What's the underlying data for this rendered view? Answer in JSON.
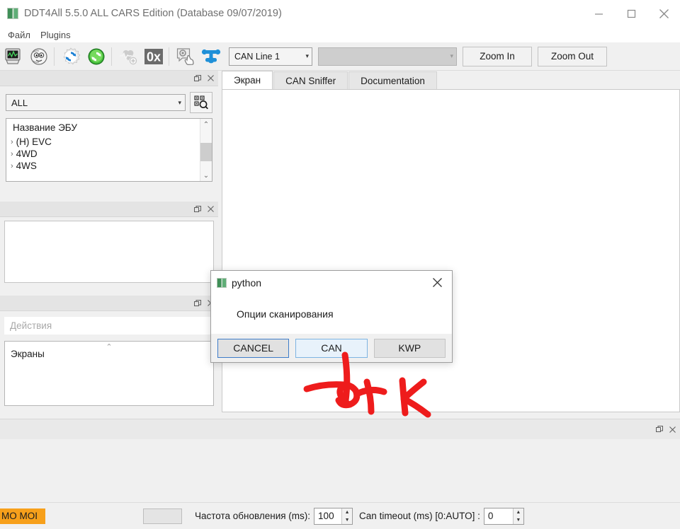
{
  "window": {
    "title": "DDT4All 5.5.0 ALL CARS Edition (Database 09/07/2019)",
    "minimize": "–",
    "maximize": "□",
    "close": "✕"
  },
  "menubar": {
    "items": [
      {
        "label": "Файл"
      },
      {
        "label": "Plugins"
      }
    ]
  },
  "toolbar": {
    "buttons": [
      {
        "name": "screen-editor-icon",
        "label": ""
      },
      {
        "name": "ecu-face-icon",
        "label": ""
      },
      {
        "name": "reload-blue-icon",
        "label": ""
      },
      {
        "name": "refresh-green-icon",
        "label": ""
      },
      {
        "name": "add-monitor-icon",
        "label": ""
      },
      {
        "name": "hex-0x-icon",
        "label": "0x"
      },
      {
        "name": "settings-hand-icon",
        "label": ""
      },
      {
        "name": "can-valve-icon",
        "label": ""
      }
    ],
    "can_line": {
      "value": "CAN Line 1",
      "caret": "▾"
    },
    "ecu_select": {
      "value": "",
      "caret": "▾"
    },
    "zoom_in": "Zoom In",
    "zoom_out": "Zoom Out"
  },
  "left_panel": {
    "ecu_panel": {
      "float_icon": "❐",
      "close_icon": "✕",
      "filter": {
        "value": "ALL",
        "caret": "▾"
      },
      "search_icon": "qr-search-icon",
      "list_header": "Название ЭБУ",
      "items": [
        {
          "chevron": "›",
          "label": "(H) EVC"
        },
        {
          "chevron": "›",
          "label": "4WD"
        },
        {
          "chevron": "›",
          "label": "4WS"
        }
      ],
      "scroll_up": "⌃",
      "scroll_down": "⌄"
    },
    "middle_panel": {
      "float_icon": "❐",
      "close_icon": "✕"
    },
    "actions_panel": {
      "float_icon": "❐",
      "close_icon": "✕",
      "search_placeholder": "Действия",
      "collapse_icon": "⌃",
      "items": [
        {
          "label": "Экраны"
        }
      ]
    }
  },
  "main": {
    "tabs": [
      {
        "label": "Экран",
        "active": true
      },
      {
        "label": "CAN Sniffer",
        "active": false
      },
      {
        "label": "Documentation",
        "active": false
      }
    ]
  },
  "bottom_panel": {
    "float_icon": "❐",
    "close_icon": "✕"
  },
  "statusbar": {
    "badge": "MO MOI",
    "refresh_label": "Частота обновления (ms):",
    "refresh_value": "100",
    "timeout_label": "Can timeout (ms) [0:AUTO] :",
    "timeout_value": "0",
    "spin_up": "▲",
    "spin_down": "▼"
  },
  "dialog": {
    "title": "python",
    "close_icon": "✕",
    "message": "Опции сканирования",
    "buttons": [
      {
        "label": "CANCEL",
        "state": "default"
      },
      {
        "label": "CAN",
        "state": "hover"
      },
      {
        "label": "KWP",
        "state": "normal"
      }
    ]
  },
  "annotation": {
    "text": "Тык",
    "color": "#ee1c1c"
  },
  "colors": {
    "accent_blue": "#3d7cc9",
    "badge_orange": "#f7a01b",
    "annotation_red": "#ee1c1c"
  }
}
